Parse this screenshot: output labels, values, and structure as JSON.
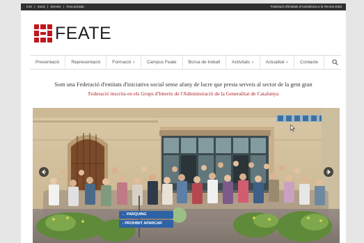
{
  "topbar": {
    "links": [
      "Inici",
      "Socis",
      "Serveis",
      "Àrea privada"
    ],
    "separator": "|",
    "right_text": "Federació d'Entitats d'Assistència a la Tercera Edat"
  },
  "logo": {
    "wordmark": "FEATE",
    "brand_color": "#c0171d"
  },
  "nav": {
    "items": [
      {
        "label": "Presentació",
        "has_submenu": false
      },
      {
        "label": "Representació",
        "has_submenu": false
      },
      {
        "label": "Formació",
        "has_submenu": true
      },
      {
        "label": "Campus Feate",
        "has_submenu": false
      },
      {
        "label": "Borsa de treball",
        "has_submenu": false
      },
      {
        "label": "Activitats",
        "has_submenu": true
      },
      {
        "label": "Actualitat",
        "has_submenu": true
      },
      {
        "label": "Contacte",
        "has_submenu": false
      }
    ],
    "submenu_marker": "»",
    "search_icon": "search-icon"
  },
  "headline": "Som una Federació d'entitats d'iniciativa social sense afany de lucre que presta serveis al sector de la gent gran",
  "subline": "Federació inscrita en els Grups d'Interès de l'Administració de la Generalitat de Catalunya",
  "slider": {
    "prev_icon": "chevron-left-icon",
    "next_icon": "chevron-right-icon",
    "sign_lines": [
      "PARQUING",
      "PROHIBIT APARCAR"
    ]
  }
}
